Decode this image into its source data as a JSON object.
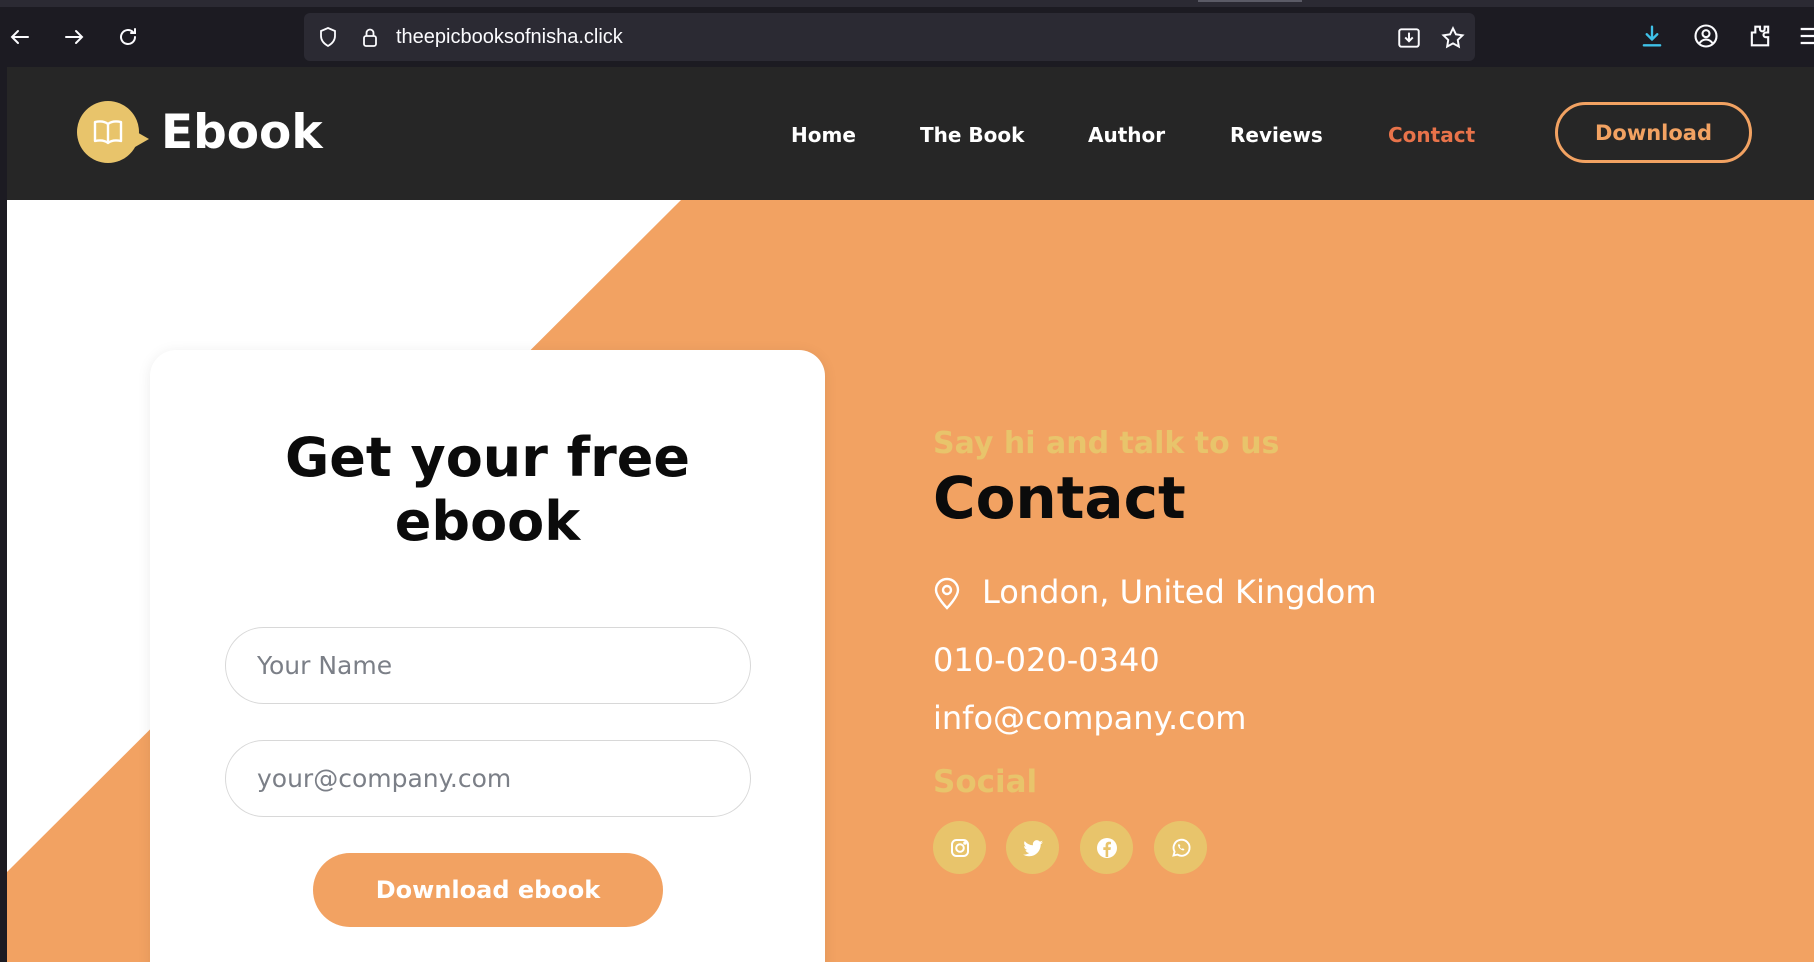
{
  "browser": {
    "url": "theepicbooksofnisha.click"
  },
  "site": {
    "logo_text": "Ebook",
    "nav": [
      {
        "label": "Home"
      },
      {
        "label": "The Book"
      },
      {
        "label": "Author"
      },
      {
        "label": "Reviews"
      },
      {
        "label": "Contact"
      }
    ],
    "download_label": "Download"
  },
  "form": {
    "title_line1": "Get your free",
    "title_line2": "ebook",
    "name_placeholder": "Your Name",
    "email_placeholder": "your@company.com",
    "submit_label": "Download ebook"
  },
  "contact": {
    "eyebrow": "Say hi and talk to us",
    "title": "Contact",
    "location": "London, United Kingdom",
    "phone": "010-020-0340",
    "email": "info@company.com",
    "social_title": "Social",
    "social": [
      "instagram-icon",
      "twitter-icon",
      "facebook-icon",
      "whatsapp-icon"
    ]
  },
  "colors": {
    "accent_orange": "#f2a262",
    "accent_yellow": "#e8c46b",
    "active_nav": "#e8734a",
    "header_bg": "#262626"
  }
}
